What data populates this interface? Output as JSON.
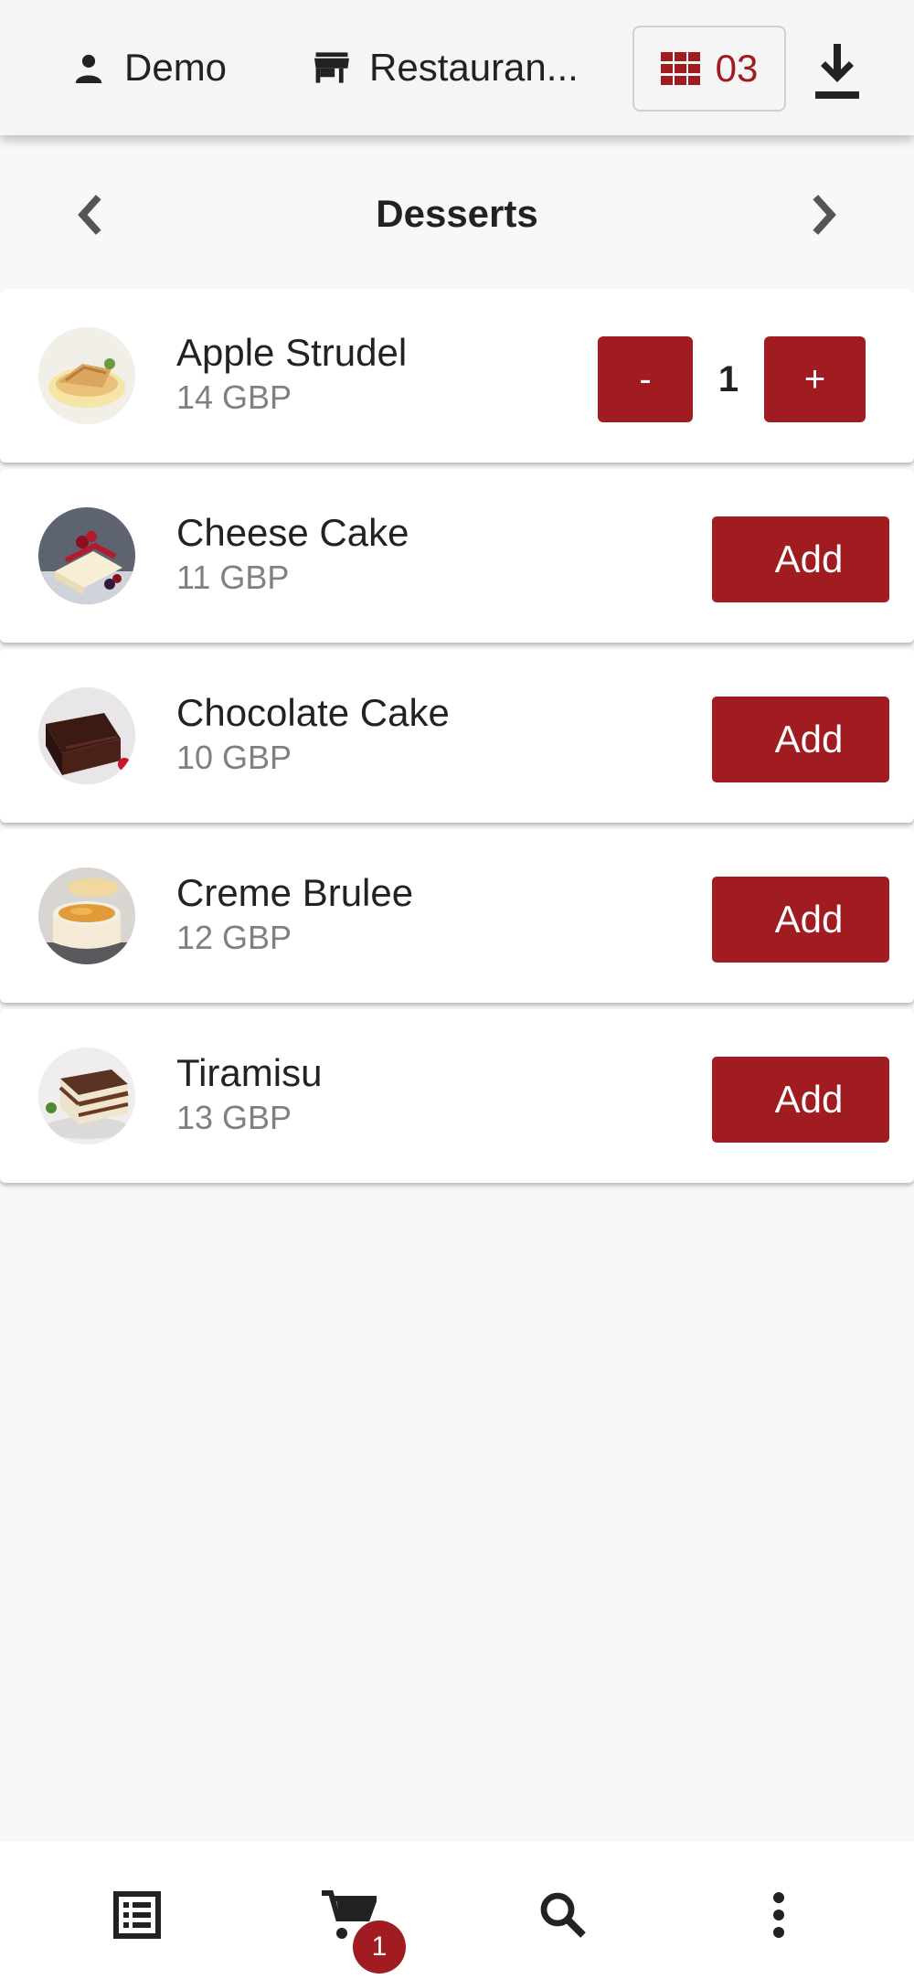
{
  "header": {
    "user_label": "Demo",
    "restaurant_label": "Restauran...",
    "table_number": "03",
    "accent_color": "#a01c20",
    "icons": {
      "user": "person-icon",
      "restaurant": "store-icon",
      "table": "table-grid-icon",
      "download": "download-icon"
    }
  },
  "category": {
    "title": "Desserts",
    "prev_icon": "chevron-left-icon",
    "next_icon": "chevron-right-icon"
  },
  "products": [
    {
      "name": "Apple Strudel",
      "price": "14 GBP",
      "quantity": "1",
      "minus_label": "-",
      "plus_label": "+"
    },
    {
      "name": "Cheese Cake",
      "price": "11 GBP",
      "action_label": "Add"
    },
    {
      "name": "Chocolate Cake",
      "price": "10 GBP",
      "action_label": "Add"
    },
    {
      "name": "Creme Brulee",
      "price": "12 GBP",
      "action_label": "Add"
    },
    {
      "name": "Tiramisu",
      "price": "13 GBP",
      "action_label": "Add"
    }
  ],
  "bottom_nav": {
    "icons": [
      "menu-list-icon",
      "cart-icon",
      "search-icon",
      "more-vertical-icon"
    ],
    "cart_badge": "1"
  }
}
